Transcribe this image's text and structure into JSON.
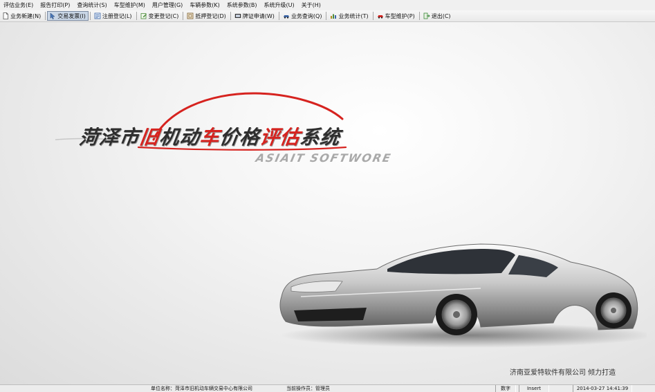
{
  "menubar": {
    "items": [
      {
        "label": "评估业务(E)"
      },
      {
        "label": "报告打印(P)"
      },
      {
        "label": "查询统计(S)"
      },
      {
        "label": "车型维护(M)"
      },
      {
        "label": "用户管理(G)"
      },
      {
        "label": "车辆参数(K)"
      },
      {
        "label": "系统参数(B)"
      },
      {
        "label": "系统升级(U)"
      },
      {
        "label": "关于(H)"
      }
    ]
  },
  "toolbar": {
    "items": [
      {
        "label": "业务新建(N)",
        "icon": "new-document-icon",
        "color": "#ffffff"
      },
      {
        "label": "交易发票(I)",
        "icon": "cursor-arrow-icon",
        "color": "#4a78b8"
      },
      {
        "label": "注册登记(L)",
        "icon": "register-icon",
        "color": "#3d67a8"
      },
      {
        "label": "变更登记(C)",
        "icon": "change-icon",
        "color": "#4a8a3a"
      },
      {
        "label": "抵押登记(D)",
        "icon": "mortgage-icon",
        "color": "#7a5a2a"
      },
      {
        "label": "牌证申请(W)",
        "icon": "license-icon",
        "color": "#333333"
      },
      {
        "label": "业务查询(Q)",
        "icon": "query-car-icon",
        "color": "#3d67a8"
      },
      {
        "label": "业务统计(T)",
        "icon": "statistics-icon",
        "color": "#b08a20"
      },
      {
        "label": "车型维护(P)",
        "icon": "car-red-icon",
        "color": "#d6231f"
      },
      {
        "label": "退出(C)",
        "icon": "exit-icon",
        "color": "#3a8a3a"
      }
    ],
    "active_index": 1
  },
  "main": {
    "title_part1": "菏泽市",
    "title_part2": "旧",
    "title_part3": "机动",
    "title_part4": "车",
    "title_part5": "价格",
    "title_part6": "评估",
    "title_part7": "系统",
    "subtitle": "ASIAIT SOFTWORE",
    "slogan": "济南亚爱特软件有限公司 倾力打造",
    "accent_color": "#d6231f"
  },
  "statusbar": {
    "unit": "单位名称：菏泽市旧机动车辆交易中心有限公司",
    "operator": "当前操作员：管理员",
    "num_lock": "数字",
    "insert": "Insert",
    "datetime": "2014-03-27 14:41:39"
  }
}
